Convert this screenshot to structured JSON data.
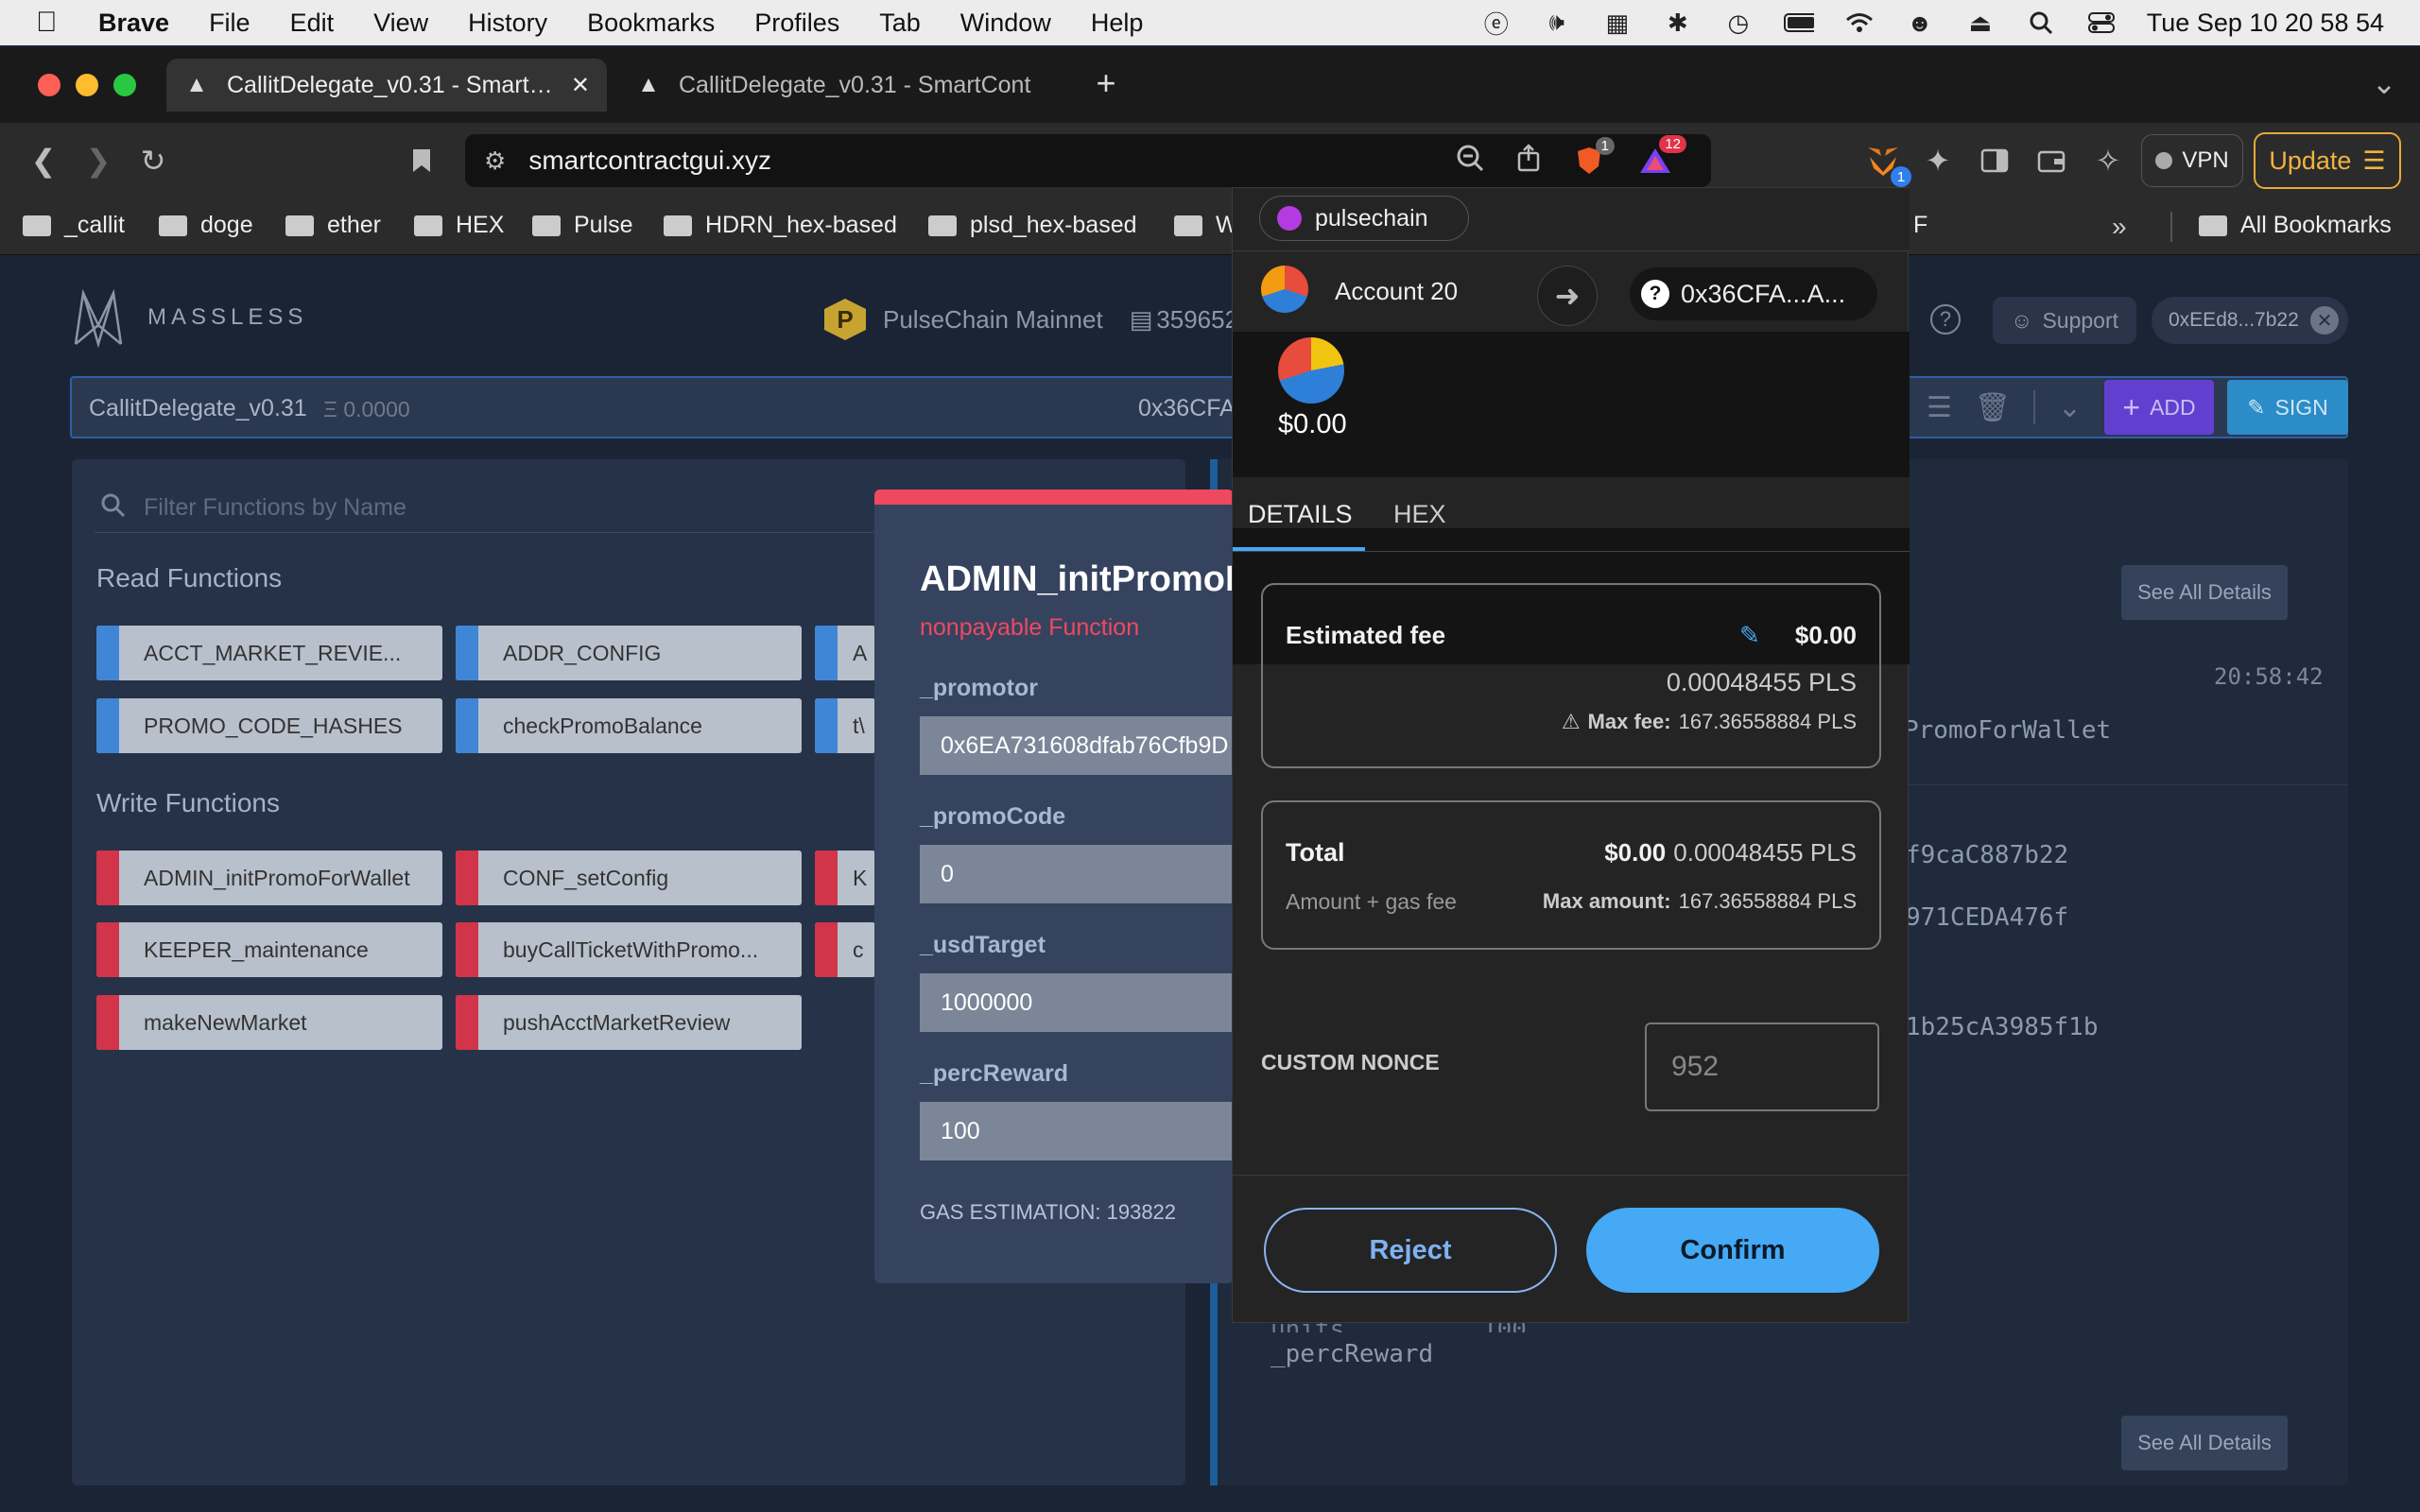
{
  "menubar": {
    "app": "Brave",
    "items": [
      "File",
      "Edit",
      "View",
      "History",
      "Bookmarks",
      "Profiles",
      "Tab",
      "Window",
      "Help"
    ],
    "clock": "Tue Sep 10  20 58 54"
  },
  "browser": {
    "tabs": [
      {
        "title": "CallitDelegate_v0.31 - Smart…",
        "close": "✕"
      },
      {
        "title": "CallitDelegate_v0.31 - SmartCont"
      }
    ],
    "new_tab": "+",
    "url": "smartcontractgui.xyz",
    "brave_shield_badge": "1",
    "rewards_badge": "12",
    "wallet_ext_badge": "1",
    "vpn_label": "VPN",
    "update_label": "Update",
    "bookmarks": [
      "_callit",
      "doge",
      "ether",
      "HEX",
      "Pulse",
      "HDRN_hex-based",
      "plsd_hex-based",
      "W"
    ],
    "bookmarks_tail": "F",
    "bookmarks_more": "»",
    "all_bookmarks": "All Bookmarks"
  },
  "app": {
    "logo_text": "MASSLESS",
    "network_letter": "P",
    "network": "PulseChain Mainnet",
    "block": "359652",
    "support": "Support",
    "account_short": "0xEEd8...7b22",
    "contract_name": "CallitDelegate_v0.31",
    "contract_balance": "Ξ 0.0000",
    "contract_addr": "0x36CFA",
    "add_label": "ADD",
    "sign_label": "SIGN",
    "filter_placeholder": "Filter Functions by Name",
    "read_title": "Read Functions",
    "write_title": "Write Functions",
    "read_functions": [
      "ACCT_MARKET_REVIE...",
      "ADDR_CONFIG",
      "A",
      "PROMO_CODE_HASHES",
      "checkPromoBalance",
      "t\\"
    ],
    "write_functions": [
      "ADMIN_initPromoForWallet",
      "CONF_setConfig",
      "K",
      "KEEPER_maintenance",
      "buyCallTicketWithPromo...",
      "c",
      "makeNewMarket",
      "pushAcctMarketReview"
    ],
    "see_all_details": "See All Details",
    "log_time": "20:58:42",
    "log_lines": [
      "PromoForWallet",
      "f9caC887b22",
      "971CEDA476f",
      "1b25cA3985f1b"
    ],
    "log_tail": "_percReward",
    "log_partial": [
      "units",
      "100"
    ]
  },
  "fn_modal": {
    "title": "ADMIN_initPromoForWallet",
    "subtitle": "nonpayable Function",
    "params": [
      {
        "name": "_promotor",
        "value": "0x6EA731608dfab76Cfb9D"
      },
      {
        "name": "_promoCode",
        "value": "0"
      },
      {
        "name": "_usdTarget",
        "value": "1000000"
      },
      {
        "name": "_percReward",
        "value": "100"
      }
    ],
    "gas_estimation": "GAS ESTIMATION: 193822"
  },
  "wallet": {
    "network": "pulsechain",
    "account": "Account 20",
    "to_address": "0x36CFA...A...",
    "balance": "$0.00",
    "tabs": [
      "DETAILS",
      "HEX"
    ],
    "fee_label": "Estimated fee",
    "fee_usd": "$0.00",
    "fee_pls": "0.00048455 PLS",
    "max_fee_label": "Max fee:",
    "max_fee_value": "167.36558884 PLS",
    "total_label": "Total",
    "total_usd": "$0.00",
    "total_pls": "0.00048455 PLS",
    "amount_gas": "Amount + gas fee",
    "max_amount_label": "Max amount:",
    "max_amount_value": "167.36558884 PLS",
    "nonce_label": "CUSTOM NONCE",
    "nonce_value": "952",
    "reject": "Reject",
    "confirm": "Confirm"
  },
  "colors": {
    "read_accent": "#3f86d6",
    "write_accent": "#d2344a",
    "confirm": "#45a9f5",
    "modal_accent": "#ef4960"
  }
}
